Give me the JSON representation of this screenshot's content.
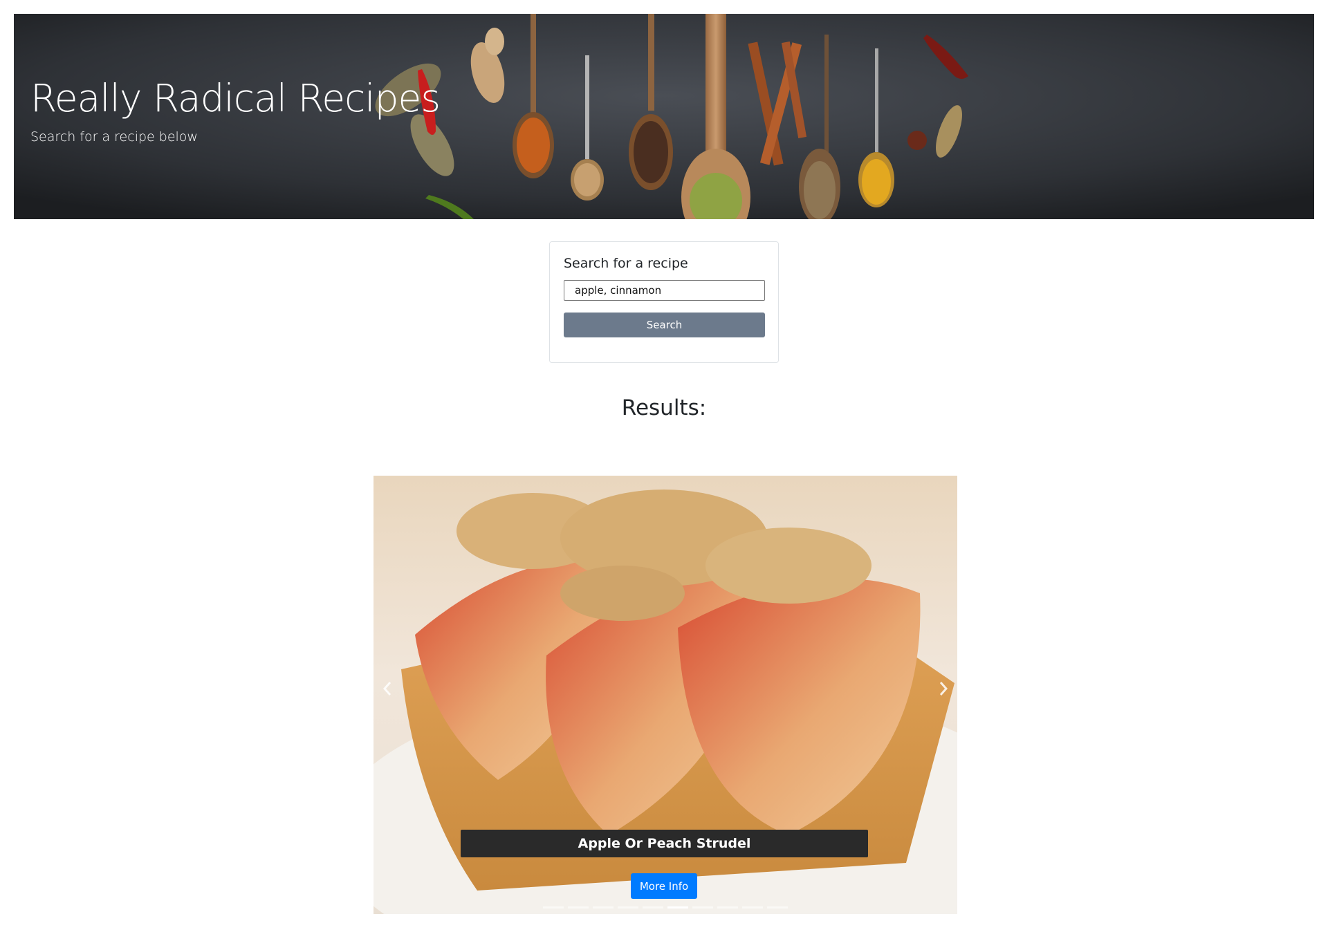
{
  "hero": {
    "title": "Really Radical Recipes",
    "subtitle": "Search for a recipe below"
  },
  "search": {
    "label": "Search for a recipe",
    "value": "apple, cinnamon",
    "button_label": "Search"
  },
  "results": {
    "heading": "Results:"
  },
  "carousel": {
    "slides_count": 10,
    "active_index": 5,
    "caption_title": "Apple Or Peach Strudel",
    "more_info_label": "More Info",
    "prev_icon": "chevron-left-icon",
    "next_icon": "chevron-right-icon"
  },
  "colors": {
    "search_button": "#6c7a8c",
    "more_info_button": "#007bff",
    "caption_bg": "#2a2a2a",
    "hero_bg": "#2b2e33"
  }
}
